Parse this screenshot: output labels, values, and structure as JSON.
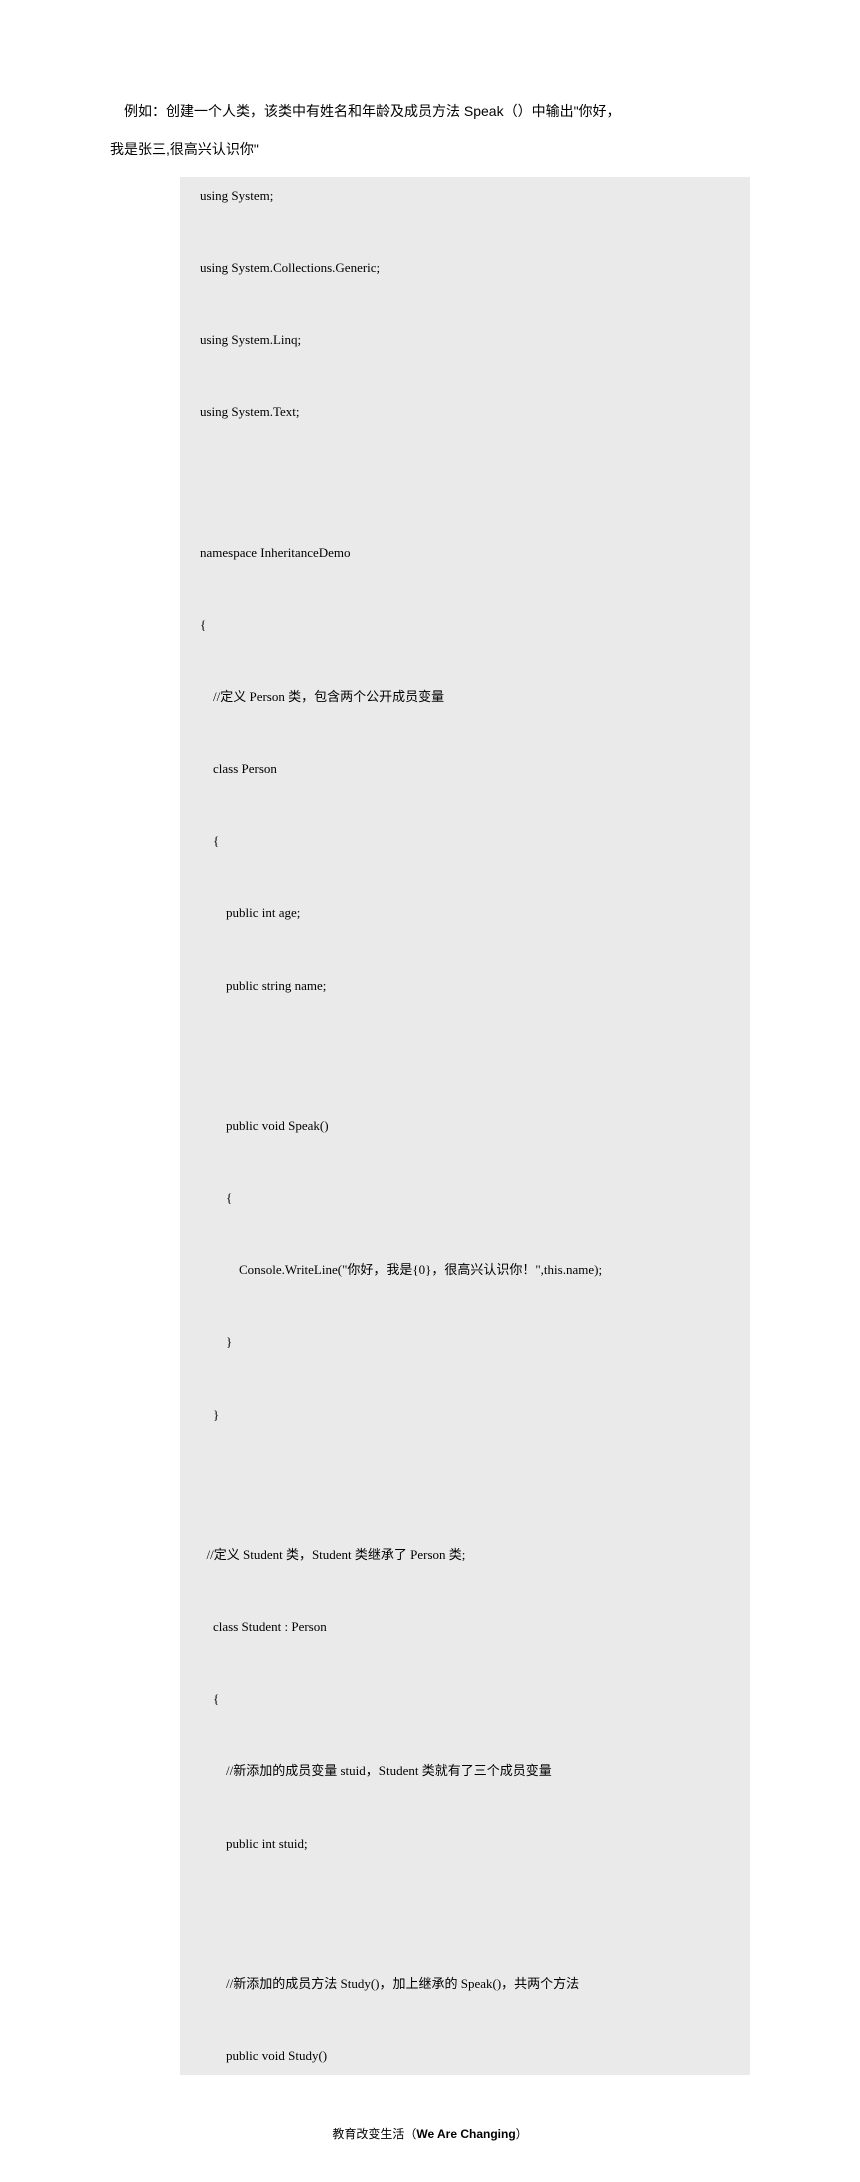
{
  "intro_line1": "例如：创建一个人类，该类中有姓名和年龄及成员方法 Speak（）中输出\"你好，",
  "intro_line2": "我是张三,很高兴认识你\"",
  "code": [
    "using System;",
    "",
    "using System.Collections.Generic;",
    "",
    "using System.Linq;",
    "",
    "using System.Text;",
    "",
    "",
    "",
    "namespace InheritanceDemo",
    "",
    "{",
    "",
    "    //定义 Person 类，包含两个公开成员变量",
    "",
    "    class Person",
    "",
    "    {",
    "",
    "        public int age;",
    "",
    "        public string name;",
    "",
    "",
    "",
    "        public void Speak()",
    "",
    "        {",
    "",
    "            Console.WriteLine(\"你好，我是{0}，很高兴认识你！\",this.name);",
    "",
    "        }",
    "",
    "    }",
    "",
    "",
    "",
    "  //定义 Student 类，Student 类继承了 Person 类;",
    "",
    "    class Student : Person",
    "",
    "    {",
    "",
    "        //新添加的成员变量 stuid，Student 类就有了三个成员变量",
    "",
    "        public int stuid;",
    "",
    "",
    "",
    "        //新添加的成员方法 Study()，加上继承的 Speak()，共两个方法",
    "",
    "        public void Study()"
  ],
  "footer_prefix": "教育改变生活（",
  "footer_bold": "We Are Changing",
  "footer_suffix": "）"
}
